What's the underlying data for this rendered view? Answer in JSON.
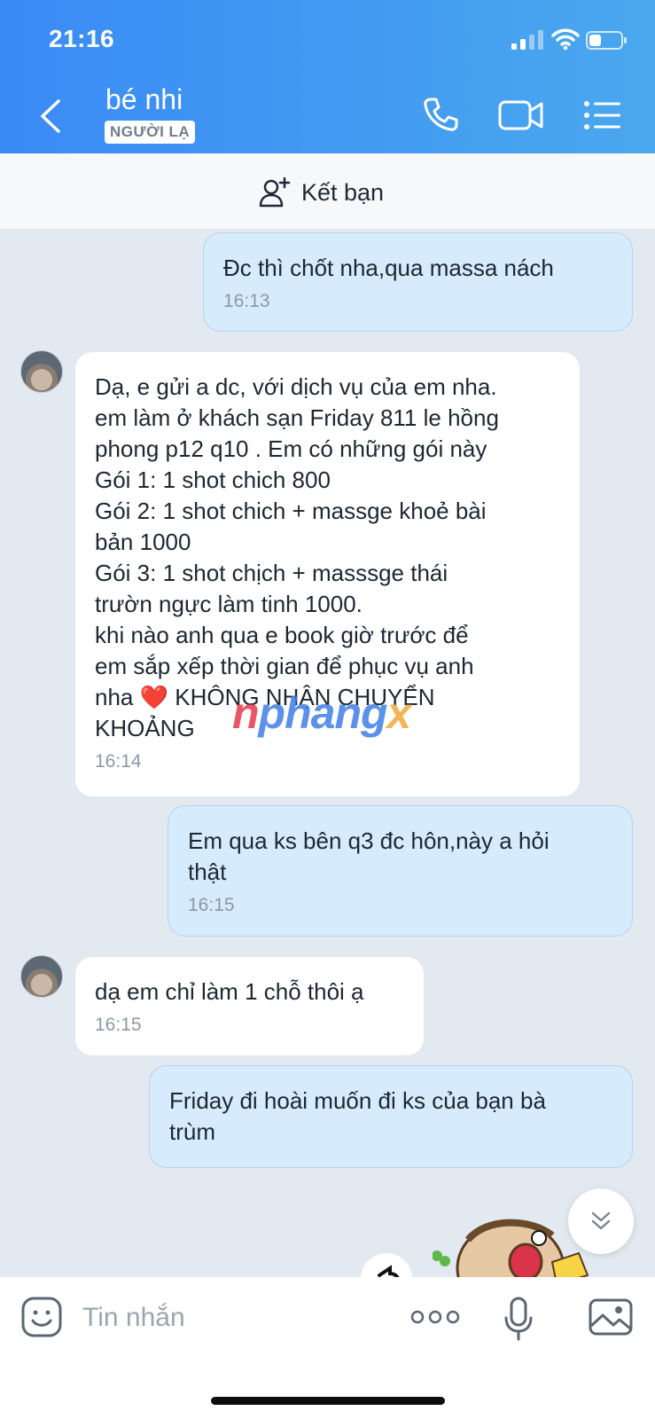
{
  "status_bar": {
    "time": "21:16"
  },
  "header": {
    "contact_name": "bé nhi",
    "badge": "NGƯỜI LẠ",
    "icons": [
      "back-icon",
      "phone-icon",
      "video-camera-icon",
      "menu-list-icon"
    ]
  },
  "add_friend": {
    "label": "Kết bạn",
    "icon": "add-user-icon"
  },
  "messages": [
    {
      "direction": "out",
      "text": "Đc thì chốt nha,qua massa nách",
      "time": "16:13"
    },
    {
      "direction": "in",
      "text": "Dạ, e gửi a dc, với dịch vụ của em nha.\nem làm ở khách sạn Friday 811 le hồng\nphong p12 q10 . Em có những gói này\nGói 1: 1 shot chich 800\nGói 2: 1 shot chich + massge khoẻ bài\nbản 1000\nGói 3: 1 shot chịch + masssge thái\ntrườn ngực làm tinh 1000.\nkhi nào anh qua e book giờ trước để\nem sắp xếp thời gian để phục vụ anh\nnha",
      "heart": "❤️",
      "text_tail": " KHÔNG NHẬN CHUYỂN\nKHOẢNG",
      "time": "16:14"
    },
    {
      "direction": "out",
      "text": "Em qua ks bên q3 đc hôn,này a hỏi\nthật",
      "time": "16:15"
    },
    {
      "direction": "in",
      "text": "dạ em chỉ làm 1 chỗ thôi ạ",
      "time": "16:15"
    },
    {
      "direction": "out",
      "text": "Friday đi hoài muốn đi ks của bạn bà\ntrùm",
      "time": ""
    }
  ],
  "watermark": {
    "part1": "n",
    "part2": "phang",
    "part3": "x"
  },
  "input_bar": {
    "placeholder": "Tin nhắn"
  },
  "colors": {
    "header_start": "#3a8af5",
    "header_end": "#4aa8ee",
    "outgoing_bubble": "#d6ebfb",
    "incoming_bubble": "#ffffff",
    "chat_background": "#e2e9f1"
  }
}
